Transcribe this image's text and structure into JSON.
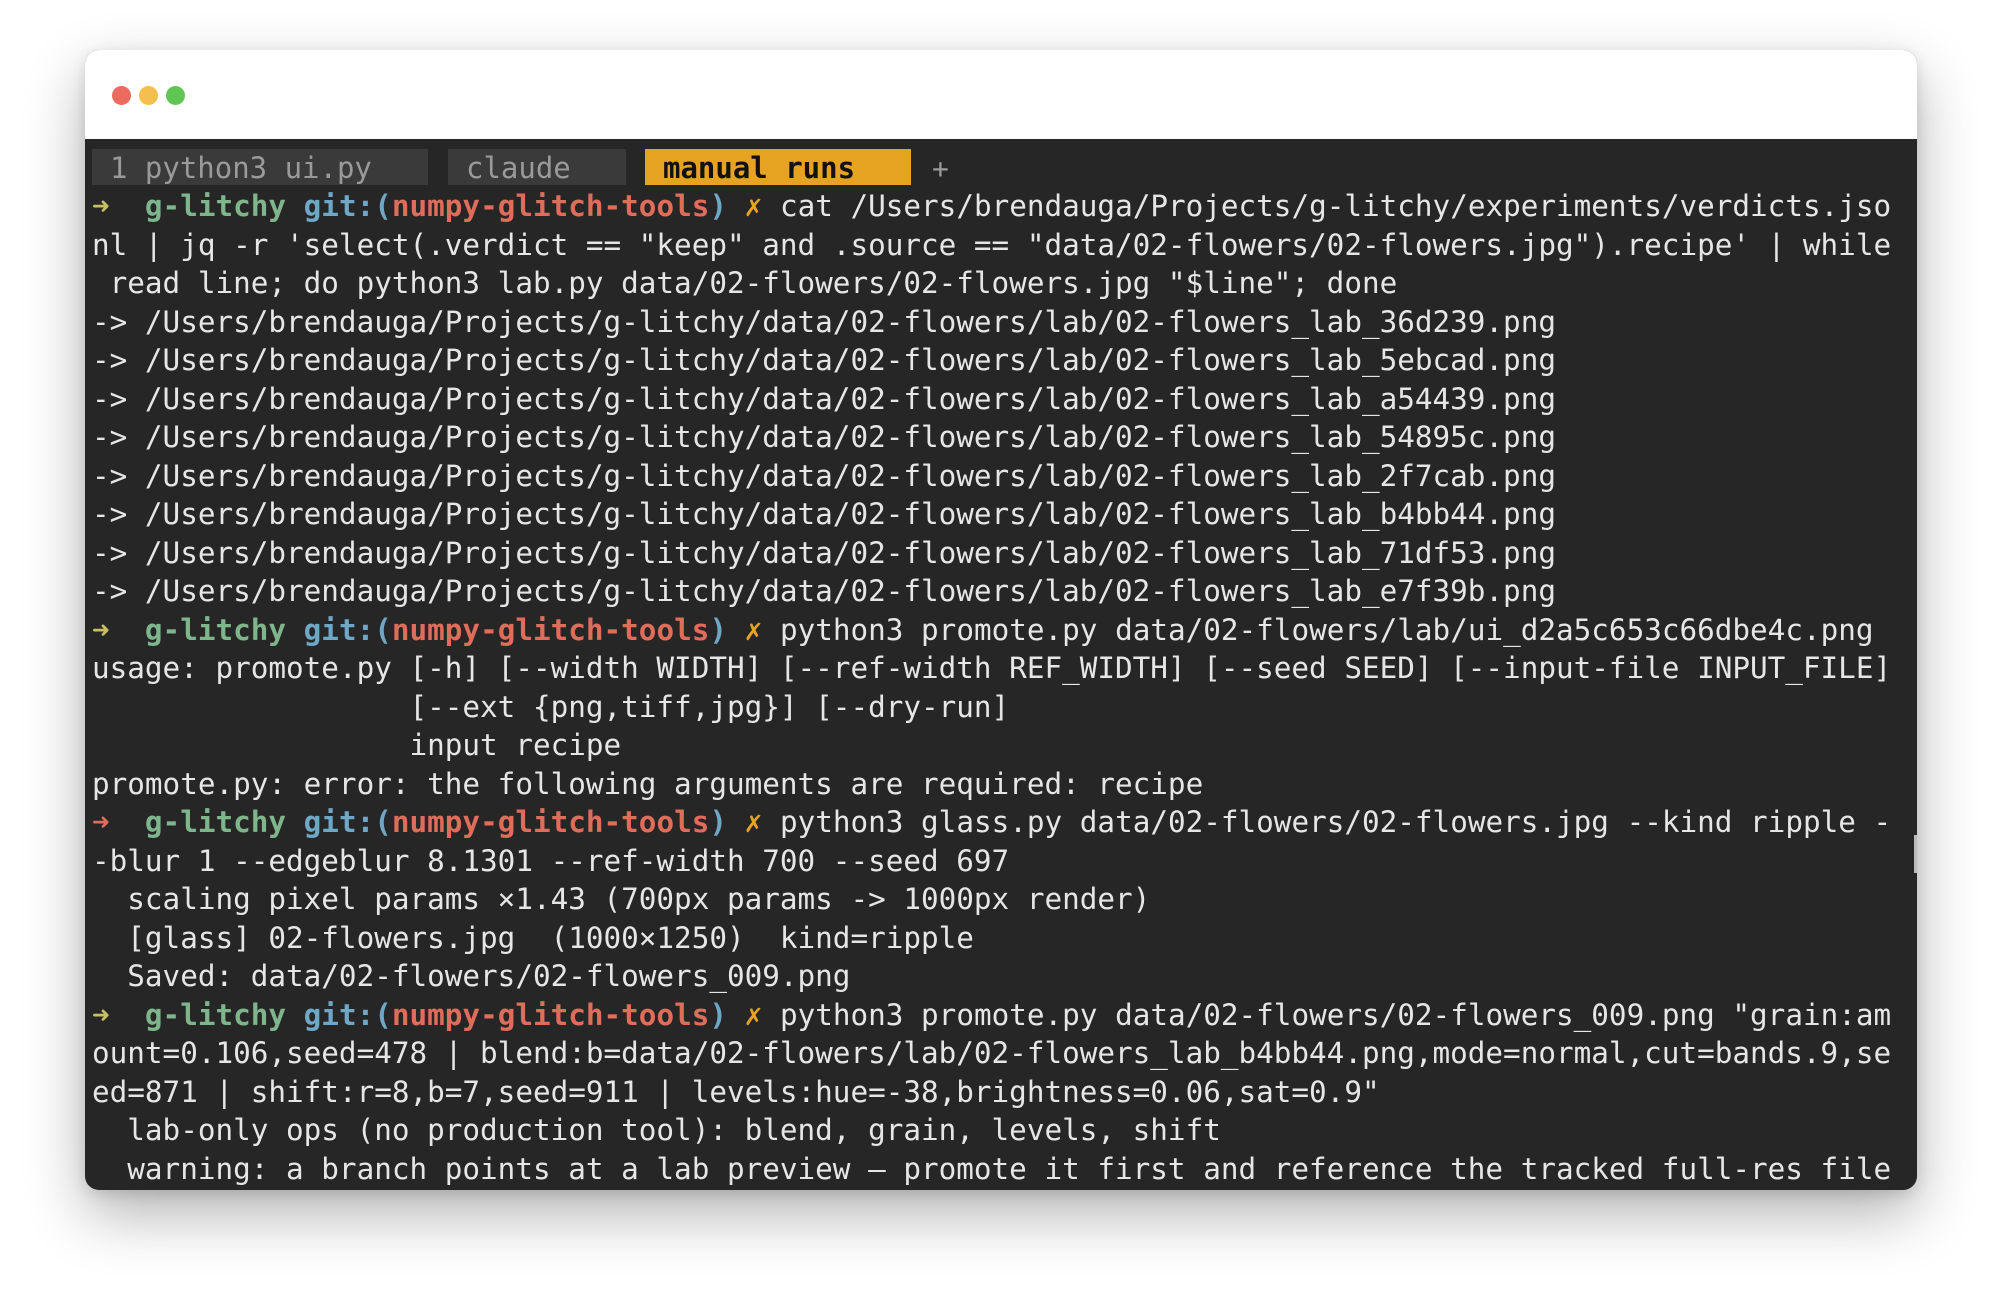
{
  "colors": {
    "close": "#ec6a5e",
    "minimize": "#f4bf4f",
    "maximize": "#61c554",
    "terminal_bg": "#262626",
    "active_tab": "#e6a321"
  },
  "tabs": [
    {
      "label": "1 python3 ui.py"
    },
    {
      "label": "claude"
    },
    {
      "label": "manual runs"
    }
  ],
  "new_tab_label": "+",
  "prompt": {
    "arrow": "➜",
    "host": "g-litchy",
    "git_prefix": "git:(",
    "branch": "numpy-glitch-tools",
    "git_suffix": ")",
    "dirty_mark": "✗"
  },
  "lines": [
    {
      "kind": "prompt",
      "arrow": "➜  ",
      "text": "cat /Users/brendauga/Projects/g-litchy/experiments/verdicts.jso"
    },
    {
      "kind": "out",
      "text": "nl | jq -r 'select(.verdict == \"keep\" and .source == \"data/02-flowers/02-flowers.jpg\").recipe' | while"
    },
    {
      "kind": "out",
      "text": " read line; do python3 lab.py data/02-flowers/02-flowers.jpg \"$line\"; done"
    },
    {
      "kind": "out",
      "text": "-> /Users/brendauga/Projects/g-litchy/data/02-flowers/lab/02-flowers_lab_36d239.png"
    },
    {
      "kind": "out",
      "text": "-> /Users/brendauga/Projects/g-litchy/data/02-flowers/lab/02-flowers_lab_5ebcad.png"
    },
    {
      "kind": "out",
      "text": "-> /Users/brendauga/Projects/g-litchy/data/02-flowers/lab/02-flowers_lab_a54439.png"
    },
    {
      "kind": "out",
      "text": "-> /Users/brendauga/Projects/g-litchy/data/02-flowers/lab/02-flowers_lab_54895c.png"
    },
    {
      "kind": "out",
      "text": "-> /Users/brendauga/Projects/g-litchy/data/02-flowers/lab/02-flowers_lab_2f7cab.png"
    },
    {
      "kind": "out",
      "text": "-> /Users/brendauga/Projects/g-litchy/data/02-flowers/lab/02-flowers_lab_b4bb44.png"
    },
    {
      "kind": "out",
      "text": "-> /Users/brendauga/Projects/g-litchy/data/02-flowers/lab/02-flowers_lab_71df53.png"
    },
    {
      "kind": "out",
      "text": "-> /Users/brendauga/Projects/g-litchy/data/02-flowers/lab/02-flowers_lab_e7f39b.png"
    },
    {
      "kind": "prompt",
      "arrow": "➜  ",
      "text": "python3 promote.py data/02-flowers/lab/ui_d2a5c653c66dbe4c.png"
    },
    {
      "kind": "out",
      "text": "usage: promote.py [-h] [--width WIDTH] [--ref-width REF_WIDTH] [--seed SEED] [--input-file INPUT_FILE]"
    },
    {
      "kind": "out",
      "text": "                  [--ext {png,tiff,jpg}] [--dry-run]"
    },
    {
      "kind": "out",
      "text": "                  input recipe"
    },
    {
      "kind": "out",
      "text": "promote.py: error: the following arguments are required: recipe"
    },
    {
      "kind": "prompt-red",
      "arrow": "➜  ",
      "text": "python3 glass.py data/02-flowers/02-flowers.jpg --kind ripple -"
    },
    {
      "kind": "out",
      "text": "-blur 1 --edgeblur 8.1301 --ref-width 700 --seed 697"
    },
    {
      "kind": "out",
      "text": "  scaling pixel params ×1.43 (700px params -> 1000px render)"
    },
    {
      "kind": "out",
      "text": "  [glass] 02-flowers.jpg  (1000×1250)  kind=ripple"
    },
    {
      "kind": "out",
      "text": "  Saved: data/02-flowers/02-flowers_009.png"
    },
    {
      "kind": "prompt",
      "arrow": "➜  ",
      "text": "python3 promote.py data/02-flowers/02-flowers_009.png \"grain:am"
    },
    {
      "kind": "out",
      "text": "ount=0.106,seed=478 | blend:b=data/02-flowers/lab/02-flowers_lab_b4bb44.png,mode=normal,cut=bands.9,se"
    },
    {
      "kind": "out",
      "text": "ed=871 | shift:r=8,b=7,seed=911 | levels:hue=-38,brightness=0.06,sat=0.9\""
    },
    {
      "kind": "out",
      "text": "  lab-only ops (no production tool): blend, grain, levels, shift"
    },
    {
      "kind": "out",
      "text": "  warning: a branch points at a lab preview — promote it first and reference the tracked full-res file"
    }
  ]
}
